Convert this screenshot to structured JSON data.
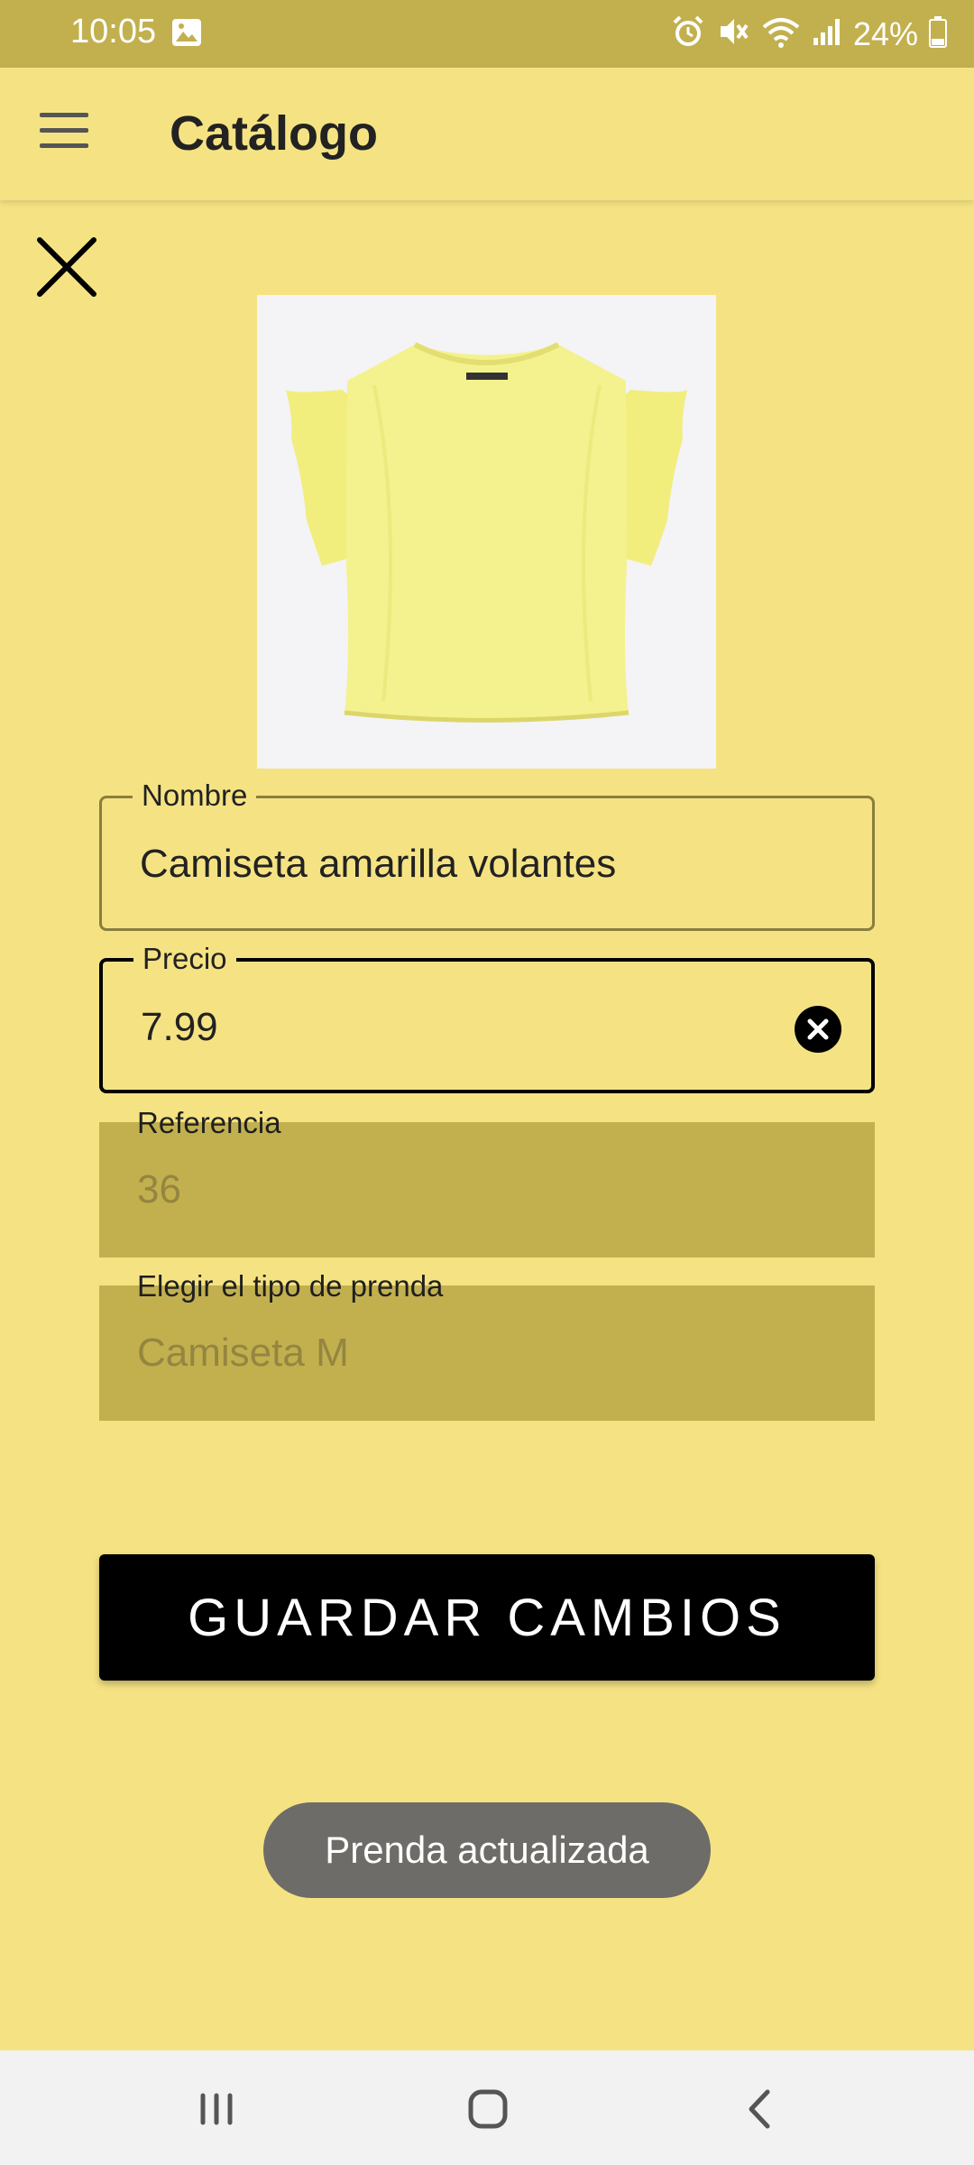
{
  "status_bar": {
    "time": "10:05",
    "battery": "24%",
    "icons": [
      "gallery-icon",
      "alarm-icon",
      "mute-icon",
      "wifi-icon",
      "signal-icon",
      "battery-icon"
    ]
  },
  "app_bar": {
    "title": "Catálogo",
    "menu_icon": "hamburger-menu-icon"
  },
  "form": {
    "close_icon": "close-icon",
    "image_description": "yellow ruffle-sleeve t-shirt",
    "nombre": {
      "label": "Nombre",
      "value": "Camiseta amarilla volantes"
    },
    "precio": {
      "label": "Precio",
      "value": "7.99",
      "clear_icon": "clear-circle-icon"
    },
    "referencia": {
      "label": "Referencia",
      "value": "36"
    },
    "tipo": {
      "label": "Elegir el tipo de prenda",
      "value": "Camiseta M"
    },
    "save_label": "GUARDAR CAMBIOS"
  },
  "toast": {
    "text": "Prenda actualizada"
  },
  "nav_bar": {
    "icons": [
      "recent-apps-icon",
      "home-icon",
      "back-icon"
    ]
  },
  "colors": {
    "background": "#F5E383",
    "status_bar": "#C2B04F",
    "disabled_field": "#C2B04F",
    "button": "#000000",
    "toast": "#6E6C68"
  }
}
